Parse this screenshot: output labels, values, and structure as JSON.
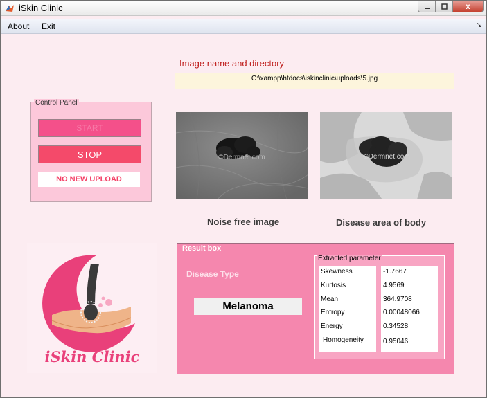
{
  "window": {
    "title": "iSkin Clinic",
    "close_glyph": "x"
  },
  "menu": {
    "items": [
      "About",
      "Exit"
    ],
    "arrow": "↘"
  },
  "image_section": {
    "label": "Image name and directory",
    "path": "C:\\xampp\\htdocs\\iskinclinic\\uploads\\5.jpg"
  },
  "control_panel": {
    "title": "Control Panel",
    "start_label": "START",
    "stop_label": "STOP",
    "status": "NO NEW UPLOAD"
  },
  "images": {
    "noise_caption": "Noise free image",
    "disease_caption": "Disease area of body",
    "watermark": "©Dermnet.com"
  },
  "logo": {
    "text": "iSkin Clinic"
  },
  "result": {
    "title": "Result box",
    "disease_type_label": "Disease Type",
    "disease_value": "Melanoma",
    "params_title": "Extracted parameter",
    "params": [
      {
        "name": "Skewness",
        "value": "-1.7667"
      },
      {
        "name": "Kurtosis",
        "value": "4.9569"
      },
      {
        "name": "Mean",
        "value": "364.9708"
      },
      {
        "name": "Entropy",
        "value": "0.00048066"
      },
      {
        "name": "Energy",
        "value": "0.34528"
      },
      {
        "name": "Homogeneity",
        "value": "0.95046"
      }
    ]
  },
  "colors": {
    "background": "#fcecf1",
    "accent_pink": "#f587ae",
    "label_red": "#c0201e",
    "stop_button": "#f44a6a"
  }
}
